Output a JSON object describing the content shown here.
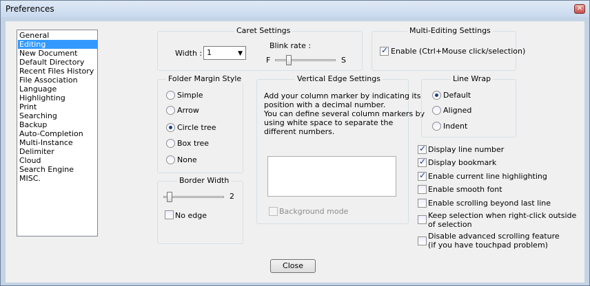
{
  "window": {
    "title": "Preferences",
    "close_glyph": "✕"
  },
  "categories": {
    "items": [
      "General",
      "Editing",
      "New Document",
      "Default Directory",
      "Recent Files History",
      "File Association",
      "Language",
      "Highlighting",
      "Print",
      "Searching",
      "Backup",
      "Auto-Completion",
      "Multi-Instance",
      "Delimiter",
      "Cloud",
      "Search Engine",
      "MISC."
    ],
    "selected": "Editing"
  },
  "caret": {
    "title": "Caret Settings",
    "width_label": "Width :",
    "width_value": "1",
    "blink_label": "Blink rate :",
    "fast_label": "F",
    "slow_label": "S"
  },
  "multi_editing": {
    "title": "Multi-Editing Settings",
    "enable_label": "Enable (Ctrl+Mouse click/selection)",
    "enable_checked": true
  },
  "folder_margin": {
    "title": "Folder Margin Style",
    "options": [
      "Simple",
      "Arrow",
      "Circle tree",
      "Box tree",
      "None"
    ],
    "selected": "Circle tree"
  },
  "vertical_edge": {
    "title": "Vertical Edge Settings",
    "description_lines": [
      "Add your column marker by indicating its",
      "position with a decimal number.",
      "You can define several column markers by",
      "using white space to separate the",
      "different numbers."
    ],
    "background_mode_label": "Background mode"
  },
  "line_wrap": {
    "title": "Line Wrap",
    "options": [
      "Default",
      "Aligned",
      "Indent"
    ],
    "selected": "Default"
  },
  "border_width": {
    "title": "Border Width",
    "value": "2",
    "no_edge_label": "No edge"
  },
  "options": [
    {
      "lines": [
        "Display line number"
      ],
      "checked": true
    },
    {
      "lines": [
        "Display bookmark"
      ],
      "checked": true
    },
    {
      "lines": [
        "Enable current line highlighting"
      ],
      "checked": true
    },
    {
      "lines": [
        "Enable smooth font"
      ],
      "checked": false
    },
    {
      "lines": [
        "Enable scrolling beyond last line"
      ],
      "checked": false
    },
    {
      "lines": [
        "Keep selection when right-click outside",
        "of selection"
      ],
      "checked": false
    },
    {
      "lines": [
        "Disable advanced scrolling feature",
        "(if you have touchpad problem)"
      ],
      "checked": false
    }
  ],
  "close_button_label": "Close",
  "colors": {
    "selection": "#3399ff",
    "dialog_bg": "#f0f0f0",
    "frame": "#c4d3e6"
  }
}
